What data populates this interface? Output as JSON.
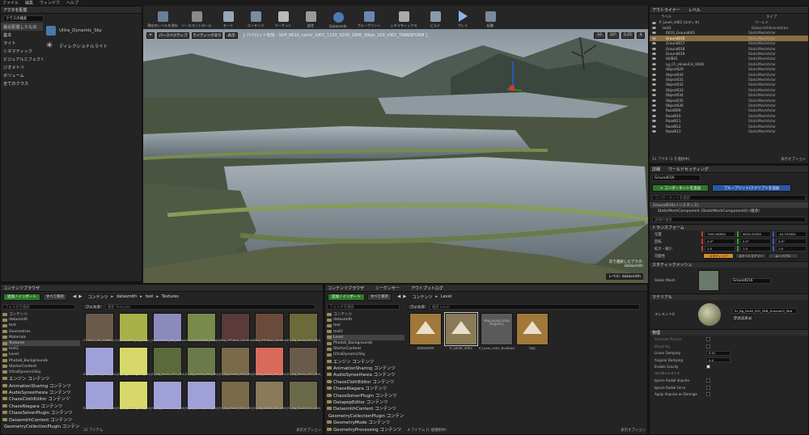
{
  "menu": [
    "ファイル",
    "編集",
    "ウィンドウ",
    "ヘルプ"
  ],
  "modes": {
    "tab": "アクタを配置",
    "search": "クラスの検索"
  },
  "categories": [
    "最近配置したもの",
    "基本",
    "ライト",
    "シネマティック",
    "ビジュアルエフェクト",
    "ジオメトリ",
    "ボリューム",
    "全てのクラス"
  ],
  "placeItems": [
    "Ultra_Dynamic_Sky",
    "ディレクショナルライト"
  ],
  "toolbar": [
    "現在のレベルを保存",
    "ソースコントロール",
    "モード",
    "コンテンツ",
    "マーケット",
    "設定",
    "Datasmith",
    "ブループリント",
    "シネマティックス",
    "ビルド",
    "プレイ",
    "起動"
  ],
  "viewport": {
    "btn1": "パースペクティブ",
    "btn2": "ライティングあり",
    "btn3": "表示",
    "pilot": "[ パイロット有効 - SHP_0610_camV_1001_1120_3200_1800_30fps_100_v001_TRANSFORM ]",
    "snap1": "10",
    "snap2": "10°",
    "snap3": "0.25",
    "snap4": "4",
    "selInfo": "次で選択したアクタ:",
    "selName": "datasmith",
    "level": "レベル: datasmith"
  },
  "outliner": {
    "tab1": "アウトライナー",
    "tab2": "レベル",
    "colLabel": "ラベル",
    "colType": "タイプ",
    "count": "51 アクタ (1 を選択中)",
    "viewOptions": "表示オプション",
    "rows": [
      {
        "l": "P_Level_v001 (エディタ)",
        "t": "ワールド"
      },
      {
        "l": "test2",
        "t": "DatasmithSceneActor"
      },
      {
        "l": "0010_Ground001",
        "t": "StaticMeshActor"
      },
      {
        "l": "Ground016",
        "t": "StaticMeshActor"
      },
      {
        "l": "Ground017",
        "t": "StaticMeshActor"
      },
      {
        "l": "Ground018",
        "t": "StaticMeshActor"
      },
      {
        "l": "Ground019",
        "t": "StaticMeshActor"
      },
      {
        "l": "HillB01",
        "t": "StaticMeshActor"
      },
      {
        "l": "Lg_Ch_HinokiCls_0040",
        "t": "StaticMeshActor"
      },
      {
        "l": "Object029",
        "t": "StaticMeshActor"
      },
      {
        "l": "Object030",
        "t": "StaticMeshActor"
      },
      {
        "l": "Object031",
        "t": "StaticMeshActor"
      },
      {
        "l": "Object032",
        "t": "StaticMeshActor"
      },
      {
        "l": "Object033",
        "t": "StaticMeshActor"
      },
      {
        "l": "Object034",
        "t": "StaticMeshActor"
      },
      {
        "l": "Object035",
        "t": "StaticMeshActor"
      },
      {
        "l": "Object036",
        "t": "StaticMeshActor"
      },
      {
        "l": "Road009",
        "t": "StaticMeshActor"
      },
      {
        "l": "Road010",
        "t": "StaticMeshActor"
      },
      {
        "l": "Road011",
        "t": "StaticMeshActor"
      },
      {
        "l": "Road012",
        "t": "StaticMeshActor"
      },
      {
        "l": "Road013",
        "t": "StaticMeshActor"
      }
    ]
  },
  "details": {
    "tab1": "詳細",
    "tab2": "ワールドセッティング",
    "name": "Ground016",
    "addComp": "+ コンポーネントを追加",
    "bpBtn": "ブループリント/スクリプトを追加",
    "compSearch": "コンポーネントを検索",
    "inst": "Ground016(インスタンス)",
    "comp": "StaticMeshComponent (StaticMeshComponent0) (継承)",
    "detSearch": "詳細の検索",
    "transform": "トランスフォーム",
    "loc": "位置",
    "rot": "回転",
    "scale": "拡大・縮小",
    "mob": "可動性",
    "locV": [
      "7500.06950",
      "5819.29250",
      "-44.333001"
    ],
    "rotV": [
      "0.0°",
      "0.0°",
      "0.0°"
    ],
    "scaleV": [
      "1.0",
      "1.0",
      "1.0"
    ],
    "mobV": [
      "スタティック",
      "ステーショナリー",
      "ムーバブル"
    ],
    "smSec": "スタティックメッシュ",
    "smLabel": "Static Mesh",
    "smValue": "Ground016",
    "matSec": "マテリアル",
    "elem": "エレメント0",
    "matValue": "Rr_Bg_DnAll_001_MtB_Ground01_Mat",
    "matOpt": "テクスチャ",
    "phys": "物理",
    "physRows": [
      "Simulate Physics",
      "MassInKg",
      "Linear Damping",
      "Angular Damping",
      "Enable Gravity",
      "コンストレイント",
      "Ignore Radial Impulse",
      "Ignore Radial Force",
      "Apply Impulse on Damage"
    ],
    "physVals": [
      "",
      "",
      "0.01",
      "0.0",
      "",
      "",
      "",
      "",
      ""
    ]
  },
  "cb1": {
    "tab": "コンテンツブラウザ",
    "add": "追加 / インポート",
    "save": "すべて保存",
    "path": [
      "コンテンツ",
      "datasmith",
      "test",
      "Textures"
    ],
    "search": "フォルダを検索",
    "filter": "フィルタ",
    "assetSearch": "検索 Textures",
    "count": "31 アイテム",
    "view": "表示オプション",
    "folders": [
      "コンテンツ",
      "datasmith",
      "test",
      "Geometries",
      "Materials",
      "Textures",
      "test2",
      "Level",
      "Photo8_Backgrounds",
      "StarterContent",
      "UltraDynamicSky",
      "エンジン コンテンツ",
      "AnimationSharing コンテンツ",
      "AudioSynesthesia コンテンツ",
      "ChaosClothEditor コンテンツ",
      "ChaosNiagara コンテンツ",
      "ChaosSolverPlugin コンテンツ",
      "DatasmithContent コンテンツ",
      "GeometryCollectionPlugin コンテンツ"
    ],
    "tex": [
      "211217_02_20MIK_c1_t1_0_Tex",
      "Ground003_8K_Color_2_0_Tex",
      "Ground003_8K_NormalGL_1_0_Tex",
      "Ground003_8K_Roughness_1_0_Tex",
      "Map_3TColor_Correction127374_Tex",
      "Map_3TColor_Correction127072_Tex",
      "Rr_Bg_DnAll_001_Mtll_Kareki_Abd_1_0",
      "Rr_Bg_DnAll_001_Mtll_Kareki_Nml_ono_1_0_Tex",
      "Rr_Bg_DnAll_001_Mtll_Kareki_Rgh_ono_1_0_Tex",
      "Rr_Bg_DnAll_001_Mtll_Mountain_Abd_1_0_Tex",
      "Rr_Bg_DnAll_001_Mtll_Mountain_Nml_1_0_Tex",
      "Rr_Bg_DnAll_001_Mtll_Mountain_Rgh_1_0_Tex",
      "Rr_Bg_DnAll_001_Mtll_Mountain_Mask_1_0_Tex",
      "Rr_Bg_DnAll_001_Mtll_Mountain_Rgh_ono_1_0_Tex",
      "Rr_Bg_DnAll_001_Mtll_Road01_Abd_1_0_Tex",
      "Rr_Bg_DnAll_001_Mtll_Road01_Nml_1_0_Tex",
      "Rr_Bg_DnAll_001_Mtll_Road01_Rgh_1_0_Tex",
      "Rr_Bg_DnAll_001_Mtll_Road01_v002_Rgh_1_0_Tex",
      "Rr_Bg_DnAll_001_Mtll_TanboGround_Abd_1_0_Tex",
      "Rr_Bg_DnAll_001_Mtll_TanboGround_Nml_1_0_Tex",
      "Rr_Bg_DnAll_001_Mtll_TanboGround_Rgh_1_0_Tex"
    ]
  },
  "cb2": {
    "tab1": "コンテンツブラウザ",
    "tab2": "シーケンサー",
    "tab3": "アウトプットログ",
    "add": "追加 / インポート",
    "save": "すべて保存",
    "path": [
      "コンテンツ",
      "Level"
    ],
    "search": "フォルダを検索",
    "filter": "フィルタ",
    "assetSearch": "検索 Level",
    "count": "4 アイテム (1 個選択中)",
    "view": "表示オプション",
    "folders": [
      "コンテンツ",
      "datasmith",
      "test",
      "test2",
      "Level",
      "Photo8_Backgrounds",
      "StarterContent",
      "UltraDynamicSky",
      "エンジン コンテンツ",
      "AnimationSharing コンテンツ",
      "AudioSynesthesia コンテンツ",
      "ChaosClothEditor コンテンツ",
      "ChaosNiagara コンテンツ",
      "ChaosSolverPlugin コンテンツ",
      "DatapepEditor コンテンツ",
      "DatasmithContent コンテンツ",
      "GeometryCollectionPlugin コンテンツ",
      "GeometryMode コンテンツ",
      "GeometryProcessing コンテンツ"
    ],
    "assets": [
      "datasmith",
      "P_Level_v001",
      "Map Build Data Registry",
      "Sky"
    ],
    "assetSubs": [
      "",
      "",
      "P_Level_v001_BuiltData",
      ""
    ]
  }
}
